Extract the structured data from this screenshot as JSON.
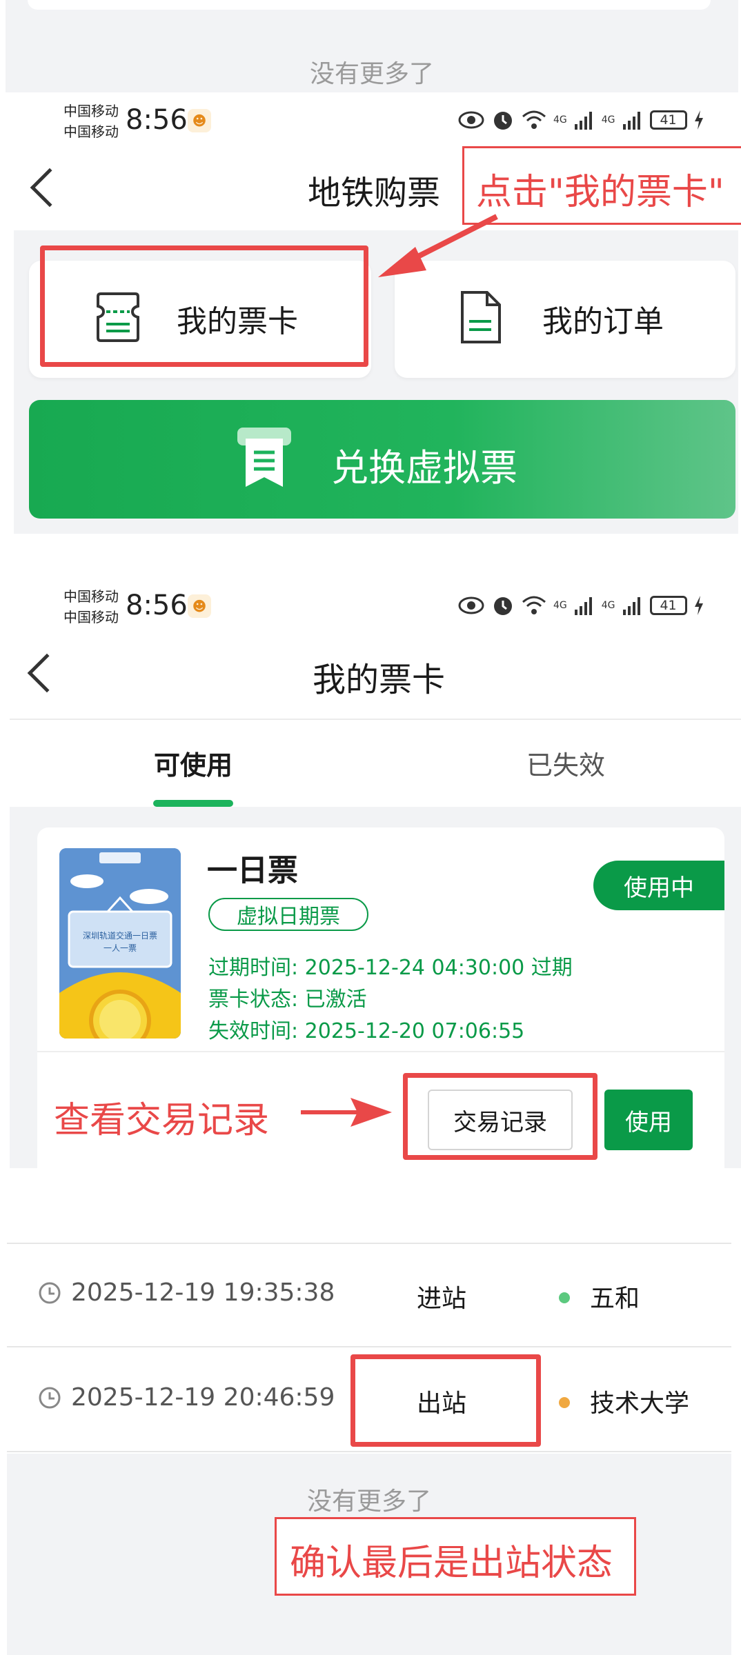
{
  "colors": {
    "brand_green": "#1cb35c",
    "status_green": "#0a9a48",
    "annotation_red": "#e94848",
    "dot_green": "#5cc97f",
    "dot_orange": "#f0a840",
    "page_bg": "#f2f3f5"
  },
  "top_section": {
    "no_more_text": "没有更多了"
  },
  "status_bar": {
    "carrier_1": "中国移动",
    "carrier_2": "中国移动",
    "time": "8:56",
    "net_1": "4G",
    "net_2": "4G",
    "battery": "41",
    "icons": [
      "eye-icon",
      "alarm-icon",
      "wifi-icon",
      "signal-icon",
      "signal-icon",
      "battery-icon",
      "charging-icon"
    ]
  },
  "screen1": {
    "title": "地铁购票",
    "my_cards_label": "我的票卡",
    "my_orders_label": "我的订单",
    "redeem_label": "兑换虚拟票",
    "annotation": "点击\"我的票卡\""
  },
  "screen2": {
    "title": "我的票卡",
    "tabs": [
      {
        "label": "可使用",
        "active": true
      },
      {
        "label": "已失效",
        "active": false
      }
    ],
    "ticket": {
      "name": "一日票",
      "type_badge": "虚拟日期票",
      "status_badge": "使用中",
      "expire_line": "过期时间: 2025-12-24 04:30:00 过期",
      "state_line": "票卡状态: 已激活",
      "invalid_line": "失效时间: 2025-12-20 07:06:55",
      "image_text_1": "深圳轨道交通一日票",
      "image_text_2": "一人一票"
    },
    "records_button": "交易记录",
    "use_button": "使用",
    "annotation": "查看交易记录"
  },
  "screen3": {
    "records": [
      {
        "time": "2025-12-19 19:35:38",
        "status": "进站",
        "station": "五和",
        "dot": "green"
      },
      {
        "time": "2025-12-19 20:46:59",
        "status": "出站",
        "station": "技术大学",
        "dot": "orange"
      }
    ],
    "no_more_text": "没有更多了",
    "annotation": "确认最后是出站状态"
  }
}
